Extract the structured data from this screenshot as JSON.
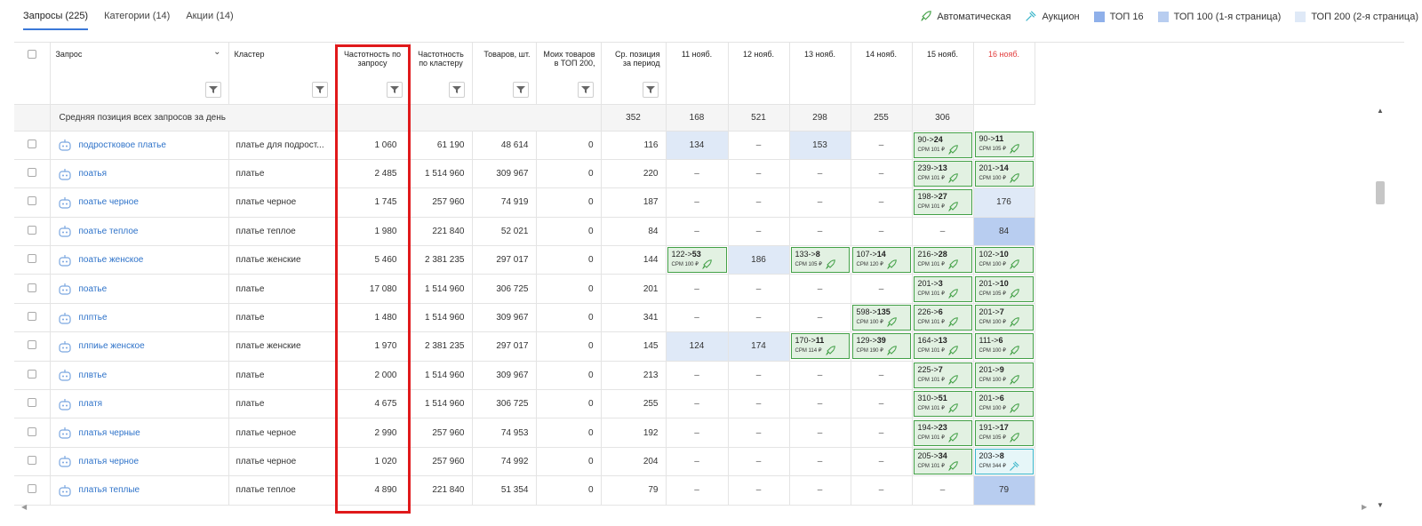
{
  "tabs": [
    {
      "label": "Запросы (225)",
      "active": true
    },
    {
      "label": "Категории (14)",
      "active": false
    },
    {
      "label": "Акции (14)",
      "active": false
    }
  ],
  "legend": [
    {
      "label": "Автоматическая",
      "icon": "rocket-icon",
      "color": "#43a047"
    },
    {
      "label": "Аукцион",
      "icon": "hammer-icon",
      "color": "#39b5c9"
    },
    {
      "label": "ТОП 16",
      "color": "#8fb0ea"
    },
    {
      "label": "ТОП 100 (1-я страница)",
      "color": "#b8cdf0"
    },
    {
      "label": "ТОП 200 (2-я страница)",
      "color": "#dfe9f7"
    }
  ],
  "columns": {
    "query": "Запрос",
    "cluster": "Кластер",
    "freq_query": "Частотность по запросу",
    "freq_cluster": "Частотность по кластеру",
    "goods": "Товаров, шт.",
    "my_goods": "Моих товаров в ТОП 200,",
    "avg_pos": "Ср. позиция за период",
    "dates": [
      "11 нояб.",
      "12 нояб.",
      "13 нояб.",
      "14 нояб.",
      "15 нояб.",
      "16 нояб."
    ]
  },
  "avg_row": {
    "label": "Средняя позиция всех запросов за день",
    "values": [
      "352",
      "168",
      "521",
      "298",
      "255",
      "306"
    ]
  },
  "rows": [
    {
      "query": "подростковое платье",
      "cluster": "платье для подрост...",
      "fq": "1 060",
      "fc": "61 190",
      "goods": "48 614",
      "my": "0",
      "avg": "116",
      "days": [
        {
          "t": "t100",
          "v": "134"
        },
        {
          "t": "dash",
          "v": "–"
        },
        {
          "t": "t100",
          "v": "153"
        },
        {
          "t": "dash",
          "v": "–"
        },
        {
          "t": "bid",
          "from": "90",
          "to": "24",
          "cpm": "CPM 101 ₽"
        },
        {
          "t": "bid",
          "from": "90",
          "to": "11",
          "cpm": "CPM 105 ₽"
        }
      ]
    },
    {
      "query": "поатья",
      "cluster": "платье",
      "fq": "2 485",
      "fc": "1 514 960",
      "goods": "309 967",
      "my": "0",
      "avg": "220",
      "days": [
        {
          "t": "dash",
          "v": "–"
        },
        {
          "t": "dash",
          "v": "–"
        },
        {
          "t": "dash",
          "v": "–"
        },
        {
          "t": "dash",
          "v": "–"
        },
        {
          "t": "bid",
          "from": "239",
          "to": "13",
          "cpm": "CPM 101 ₽"
        },
        {
          "t": "bid",
          "from": "201",
          "to": "14",
          "cpm": "CPM 100 ₽"
        }
      ]
    },
    {
      "query": "поатье черное",
      "cluster": "платье черное",
      "fq": "1 745",
      "fc": "257 960",
      "goods": "74 919",
      "my": "0",
      "avg": "187",
      "days": [
        {
          "t": "dash",
          "v": "–"
        },
        {
          "t": "dash",
          "v": "–"
        },
        {
          "t": "dash",
          "v": "–"
        },
        {
          "t": "dash",
          "v": "–"
        },
        {
          "t": "bid",
          "from": "198",
          "to": "27",
          "cpm": "CPM 101 ₽"
        },
        {
          "t": "t100",
          "v": "176"
        }
      ]
    },
    {
      "query": "поатье теплое",
      "cluster": "платье теплое",
      "fq": "1 980",
      "fc": "221 840",
      "goods": "52 021",
      "my": "0",
      "avg": "84",
      "days": [
        {
          "t": "dash",
          "v": "–"
        },
        {
          "t": "dash",
          "v": "–"
        },
        {
          "t": "dash",
          "v": "–"
        },
        {
          "t": "dash",
          "v": "–"
        },
        {
          "t": "dash",
          "v": "–"
        },
        {
          "t": "t16",
          "v": "84"
        }
      ]
    },
    {
      "query": "поатье женское",
      "cluster": "платье женские",
      "fq": "5 460",
      "fc": "2 381 235",
      "goods": "297 017",
      "my": "0",
      "avg": "144",
      "days": [
        {
          "t": "bid",
          "from": "122",
          "to": "53",
          "cpm": "CPM 100 ₽"
        },
        {
          "t": "t100",
          "v": "186"
        },
        {
          "t": "bid",
          "from": "133",
          "to": "8",
          "cpm": "CPM 105 ₽"
        },
        {
          "t": "bid",
          "from": "107",
          "to": "14",
          "cpm": "CPM 120 ₽"
        },
        {
          "t": "bid",
          "from": "216",
          "to": "28",
          "cpm": "CPM 101 ₽"
        },
        {
          "t": "bid",
          "from": "102",
          "to": "10",
          "cpm": "CPM 100 ₽"
        }
      ]
    },
    {
      "query": "поатье",
      "cluster": "платье",
      "fq": "17 080",
      "fc": "1 514 960",
      "goods": "306 725",
      "my": "0",
      "avg": "201",
      "days": [
        {
          "t": "dash",
          "v": "–"
        },
        {
          "t": "dash",
          "v": "–"
        },
        {
          "t": "dash",
          "v": "–"
        },
        {
          "t": "dash",
          "v": "–"
        },
        {
          "t": "bid",
          "from": "201",
          "to": "3",
          "cpm": "CPM 101 ₽"
        },
        {
          "t": "bid",
          "from": "201",
          "to": "10",
          "cpm": "CPM 105 ₽"
        }
      ]
    },
    {
      "query": "плптье",
      "cluster": "платье",
      "fq": "1 480",
      "fc": "1 514 960",
      "goods": "309 967",
      "my": "0",
      "avg": "341",
      "days": [
        {
          "t": "dash",
          "v": "–"
        },
        {
          "t": "dash",
          "v": "–"
        },
        {
          "t": "dash",
          "v": "–"
        },
        {
          "t": "bid",
          "from": "598",
          "to": "135",
          "cpm": "CPM 100 ₽"
        },
        {
          "t": "bid",
          "from": "226",
          "to": "6",
          "cpm": "CPM 101 ₽"
        },
        {
          "t": "bid",
          "from": "201",
          "to": "7",
          "cpm": "CPM 100 ₽"
        }
      ]
    },
    {
      "query": "плпиье женское",
      "cluster": "платье женские",
      "fq": "1 970",
      "fc": "2 381 235",
      "goods": "297 017",
      "my": "0",
      "avg": "145",
      "days": [
        {
          "t": "t100",
          "v": "124"
        },
        {
          "t": "t100",
          "v": "174"
        },
        {
          "t": "bid",
          "from": "170",
          "to": "11",
          "cpm": "CPM 114 ₽"
        },
        {
          "t": "bid",
          "from": "129",
          "to": "39",
          "cpm": "CPM 190 ₽"
        },
        {
          "t": "bid",
          "from": "164",
          "to": "13",
          "cpm": "CPM 101 ₽"
        },
        {
          "t": "bid",
          "from": "111",
          "to": "6",
          "cpm": "CPM 100 ₽"
        }
      ]
    },
    {
      "query": "плвтье",
      "cluster": "платье",
      "fq": "2 000",
      "fc": "1 514 960",
      "goods": "309 967",
      "my": "0",
      "avg": "213",
      "days": [
        {
          "t": "dash",
          "v": "–"
        },
        {
          "t": "dash",
          "v": "–"
        },
        {
          "t": "dash",
          "v": "–"
        },
        {
          "t": "dash",
          "v": "–"
        },
        {
          "t": "bid",
          "from": "225",
          "to": "7",
          "cpm": "CPM 101 ₽"
        },
        {
          "t": "bid",
          "from": "201",
          "to": "9",
          "cpm": "CPM 100 ₽"
        }
      ]
    },
    {
      "query": "платя",
      "cluster": "платье",
      "fq": "4 675",
      "fc": "1 514 960",
      "goods": "306 725",
      "my": "0",
      "avg": "255",
      "days": [
        {
          "t": "dash",
          "v": "–"
        },
        {
          "t": "dash",
          "v": "–"
        },
        {
          "t": "dash",
          "v": "–"
        },
        {
          "t": "dash",
          "v": "–"
        },
        {
          "t": "bid",
          "from": "310",
          "to": "51",
          "cpm": "CPM 101 ₽"
        },
        {
          "t": "bid",
          "from": "201",
          "to": "6",
          "cpm": "CPM 100 ₽"
        }
      ]
    },
    {
      "query": "платья черные",
      "cluster": "платье черное",
      "fq": "2 990",
      "fc": "257 960",
      "goods": "74 953",
      "my": "0",
      "avg": "192",
      "days": [
        {
          "t": "dash",
          "v": "–"
        },
        {
          "t": "dash",
          "v": "–"
        },
        {
          "t": "dash",
          "v": "–"
        },
        {
          "t": "dash",
          "v": "–"
        },
        {
          "t": "bid",
          "from": "194",
          "to": "23",
          "cpm": "CPM 101 ₽"
        },
        {
          "t": "bid",
          "from": "191",
          "to": "17",
          "cpm": "CPM 105 ₽"
        }
      ]
    },
    {
      "query": "платья черное",
      "cluster": "платье черное",
      "fq": "1 020",
      "fc": "257 960",
      "goods": "74 992",
      "my": "0",
      "avg": "204",
      "days": [
        {
          "t": "dash",
          "v": "–"
        },
        {
          "t": "dash",
          "v": "–"
        },
        {
          "t": "dash",
          "v": "–"
        },
        {
          "t": "dash",
          "v": "–"
        },
        {
          "t": "bid",
          "from": "205",
          "to": "34",
          "cpm": "CPM 101 ₽"
        },
        {
          "t": "auc",
          "from": "203",
          "to": "8",
          "cpm": "CPM 344 ₽"
        }
      ]
    },
    {
      "query": "платья теплые",
      "cluster": "платье теплое",
      "fq": "4 890",
      "fc": "221 840",
      "goods": "51 354",
      "my": "0",
      "avg": "79",
      "days": [
        {
          "t": "dash",
          "v": "–"
        },
        {
          "t": "dash",
          "v": "–"
        },
        {
          "t": "dash",
          "v": "–"
        },
        {
          "t": "dash",
          "v": "–"
        },
        {
          "t": "dash",
          "v": "–"
        },
        {
          "t": "t16",
          "v": "79"
        }
      ]
    }
  ]
}
